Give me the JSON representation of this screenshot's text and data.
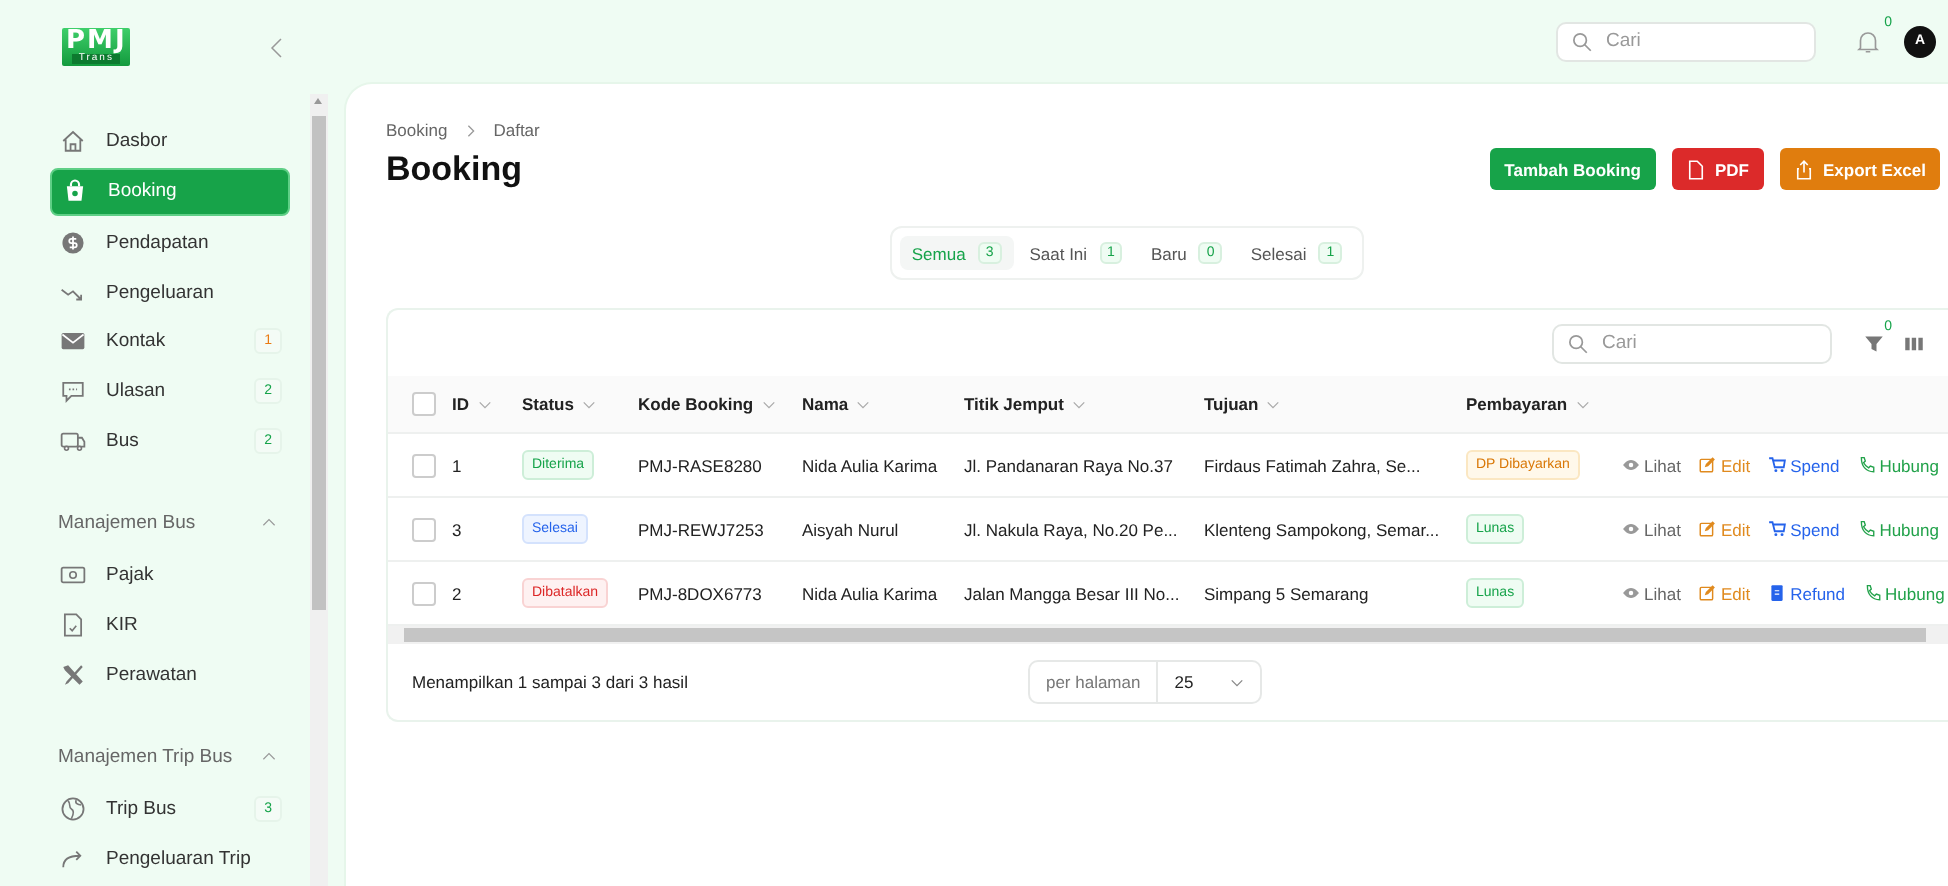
{
  "logo": {
    "name": "PMJ",
    "sub": "Trans"
  },
  "sidebar": {
    "items": [
      {
        "label": "Dasbor",
        "kind": "home",
        "selected": false
      },
      {
        "label": "Booking",
        "kind": "bag",
        "selected": true
      },
      {
        "label": "Pendapatan",
        "kind": "coin",
        "selected": false
      },
      {
        "label": "Pengeluaran",
        "kind": "trend",
        "selected": false
      },
      {
        "label": "Kontak",
        "kind": "mail",
        "selected": false,
        "badge": "1",
        "color": "#ea7a12"
      },
      {
        "label": "Ulasan",
        "kind": "chat",
        "selected": false,
        "badge": "2",
        "color": "#16a34a"
      },
      {
        "label": "Bus",
        "kind": "bus",
        "selected": false,
        "badge": "2",
        "color": "#16a34a"
      }
    ],
    "sections": [
      {
        "title": "Manajemen Bus",
        "expanded": true,
        "items": [
          {
            "label": "Pajak",
            "kind": "cash",
            "selected": false
          },
          {
            "label": "KIR",
            "kind": "doc",
            "selected": false
          },
          {
            "label": "Perawatan",
            "kind": "tools",
            "selected": false
          }
        ]
      },
      {
        "title": "Manajemen Trip Bus",
        "expanded": true,
        "items": [
          {
            "label": "Trip Bus",
            "kind": "globe",
            "selected": false,
            "badge": "3",
            "color": "#16a34a"
          },
          {
            "label": "Pengeluaran Trip",
            "kind": "redo",
            "selected": false
          }
        ]
      }
    ]
  },
  "topbar": {
    "search": {
      "placeholder": "Cari"
    },
    "notifications": "0",
    "avatar": "A"
  },
  "breadcrumb": [
    "Booking",
    "Daftar"
  ],
  "title": "Booking",
  "actions": [
    {
      "label": "Tambah Booking",
      "kind": "add"
    },
    {
      "label": "PDF",
      "kind": "pdf"
    },
    {
      "label": "Export Excel",
      "kind": "excel"
    }
  ],
  "tabs": [
    {
      "label": "Semua",
      "count": "3",
      "selected": true
    },
    {
      "label": "Saat Ini",
      "count": "1",
      "selected": false
    },
    {
      "label": "Baru",
      "count": "0",
      "selected": false
    },
    {
      "label": "Selesai",
      "count": "1",
      "selected": false
    }
  ],
  "table": {
    "search": {
      "placeholder": "Cari"
    },
    "filter_count": "0",
    "select_all": {
      "checked": false
    },
    "columns": [
      "ID",
      "Status",
      "Kode Booking",
      "Nama",
      "Titik Jemput",
      "Tujuan",
      "Pembayaran"
    ],
    "rows": [
      {
        "checked": false,
        "id": "1",
        "status": {
          "label": "Diterima",
          "kind": "accepted"
        },
        "code": "PMJ-RASE8280",
        "name": "Nida Aulia Karima",
        "pickup": "Jl. Pandanaran Raya No.37",
        "destination": "Firdaus Fatimah Zahra, Se...",
        "payment": {
          "label": "DP Dibayarkan",
          "kind": "dp"
        },
        "actions": [
          {
            "label": "Lihat",
            "kind": "view"
          },
          {
            "label": "Edit",
            "kind": "edit"
          },
          {
            "label": "Spend",
            "kind": "spend"
          },
          {
            "label": "Hubung",
            "kind": "contact"
          }
        ]
      },
      {
        "checked": false,
        "id": "3",
        "status": {
          "label": "Selesai",
          "kind": "done"
        },
        "code": "PMJ-REWJ7253",
        "name": "Aisyah Nurul",
        "pickup": "Jl. Nakula Raya, No.20 Pe...",
        "destination": "Klenteng Sampokong, Semar...",
        "payment": {
          "label": "Lunas",
          "kind": "paid"
        },
        "actions": [
          {
            "label": "Lihat",
            "kind": "view"
          },
          {
            "label": "Edit",
            "kind": "edit"
          },
          {
            "label": "Spend",
            "kind": "spend"
          },
          {
            "label": "Hubung",
            "kind": "contact"
          }
        ]
      },
      {
        "checked": false,
        "id": "2",
        "status": {
          "label": "Dibatalkan",
          "kind": "cancelled"
        },
        "code": "PMJ-8DOX6773",
        "name": "Nida Aulia Karima",
        "pickup": "Jalan Mangga Besar III No...",
        "destination": "Simpang 5 Semarang",
        "payment": {
          "label": "Lunas",
          "kind": "paid"
        },
        "actions": [
          {
            "label": "Lihat",
            "kind": "view"
          },
          {
            "label": "Edit",
            "kind": "edit"
          },
          {
            "label": "Refund",
            "kind": "refund"
          },
          {
            "label": "Hubung",
            "kind": "contact"
          }
        ]
      }
    ],
    "summary": "Menampilkan 1 sampai 3 dari 3 hasil",
    "per_page": {
      "label": "per halaman",
      "value": "25"
    }
  }
}
